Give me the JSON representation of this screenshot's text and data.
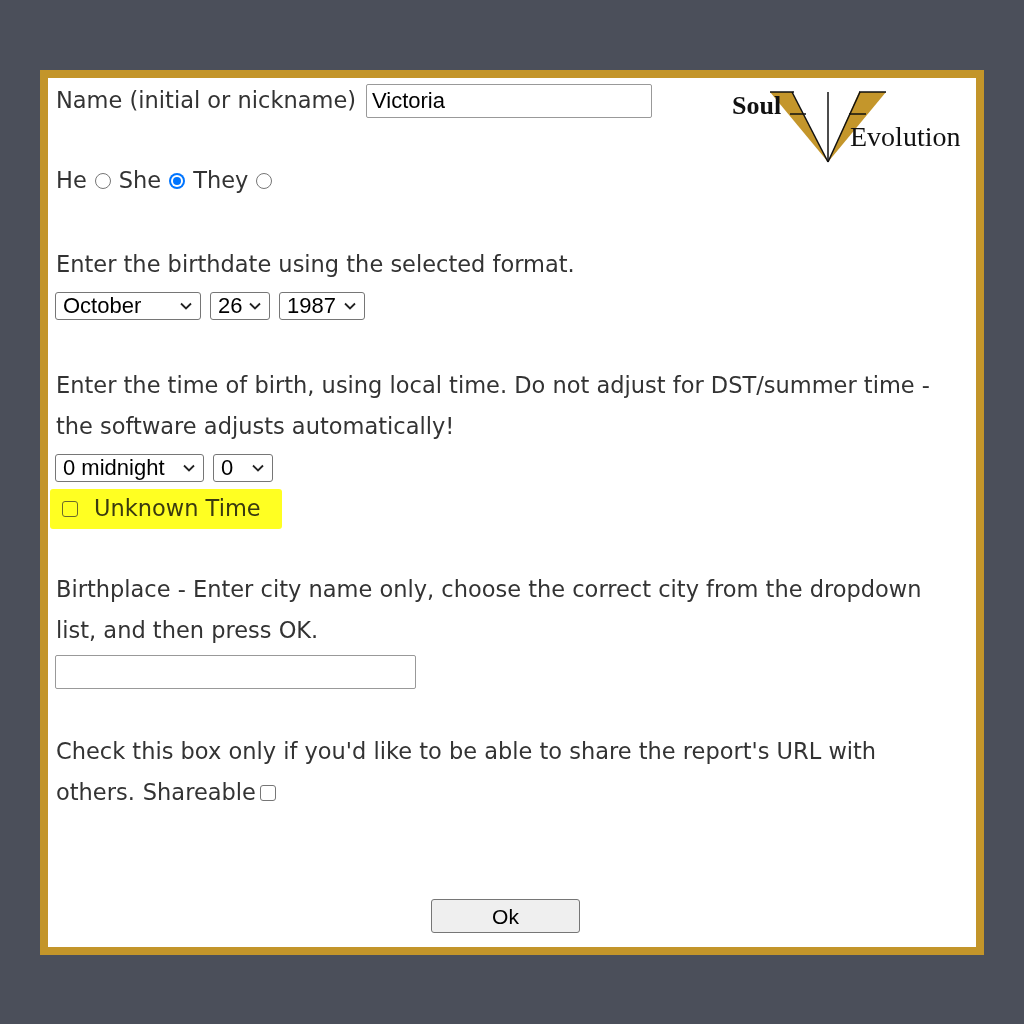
{
  "logo": {
    "word_1": "Soul",
    "word_2": "Evolution"
  },
  "name": {
    "label": "Name (initial or nickname)",
    "value": "Victoria"
  },
  "pronouns": [
    {
      "label": "He",
      "selected": false
    },
    {
      "label": "She",
      "selected": true
    },
    {
      "label": "They",
      "selected": false
    }
  ],
  "birthdate": {
    "instruction": "Enter the birthdate using the selected format.",
    "selects": [
      {
        "value": "October"
      },
      {
        "value": "26"
      },
      {
        "value": "1987"
      }
    ]
  },
  "birth_time": {
    "instruction": "Enter the time of birth, using local time. Do not adjust for DST/summer time - the software adjusts automatically!",
    "selects": [
      {
        "value": "0 midnight"
      },
      {
        "value": "0"
      }
    ],
    "unknown_time": {
      "label": "Unknown Time",
      "checked": false,
      "highlighted": true
    }
  },
  "birthplace": {
    "instruction": "Birthplace - Enter city name only, choose the correct city from the dropdown list, and then press OK."
  },
  "share": {
    "instruction": "Check this box only if you'd like to be able to share the report's URL with others.",
    "label": "Shareable",
    "checked": false
  },
  "buttons": [
    {
      "label": "Ok"
    }
  ]
}
